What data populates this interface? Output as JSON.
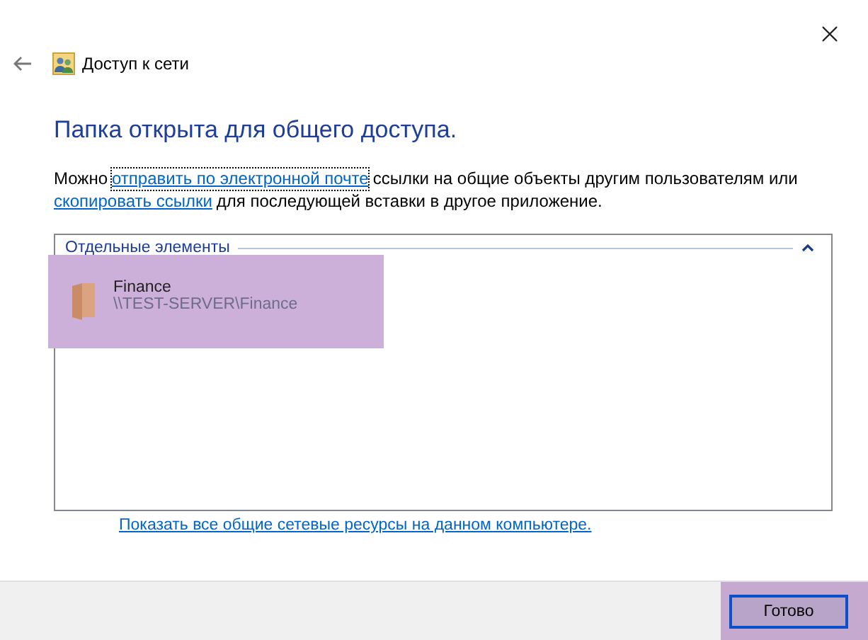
{
  "window": {
    "title": "Доступ к сети"
  },
  "heading": "Папка открыта для общего доступа.",
  "intro": {
    "before": "Можно",
    "link1": "отправить по электронной почте",
    "middle": "ссылки на общие объекты другим пользователям или",
    "link2": "скопировать ссылки",
    "after": "для последующей вставки в другое приложение."
  },
  "group": {
    "title": "Отдельные элементы",
    "expanded": true,
    "items": [
      {
        "name": "Finance",
        "path": "\\\\TEST-SERVER\\Finance",
        "selected": true
      }
    ]
  },
  "show_all_link": "Показать все общие сетевые ресурсы на данном компьютере.",
  "buttons": [
    {
      "label": "Готово",
      "highlighted": true
    }
  ]
}
